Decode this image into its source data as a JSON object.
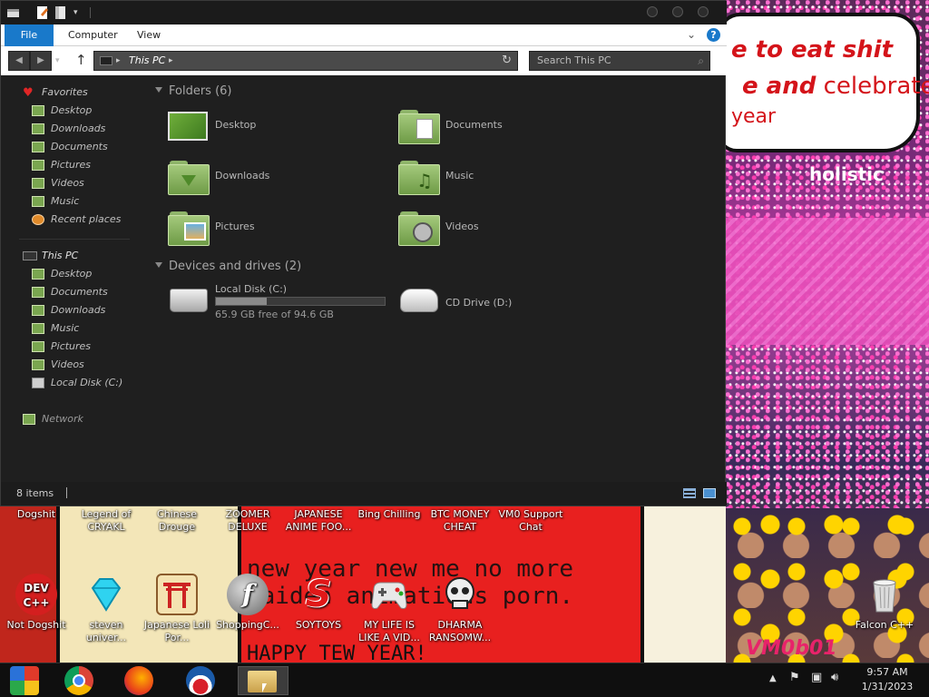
{
  "wallpaper": {
    "bubble_line1": "e to eat shit",
    "bubble_line2_bold": "e and",
    "bubble_line2_rest": "celebrate",
    "bubble_line3": "year",
    "sign_text": "holistic",
    "comic_text": "new year new me no more jaiden animations porn.",
    "comic_happy": "HAPPY TEW YEAR!",
    "signature": "VM0b01"
  },
  "desktop_icons": [
    {
      "label": "Dogshit"
    },
    {
      "label": "Legend of CRYAKL"
    },
    {
      "label": "Chinese Drouge"
    },
    {
      "label": "ZOOMER DELUXE"
    },
    {
      "label": "JAPANESE ANIME FOO..."
    },
    {
      "label": "Bing Chilling"
    },
    {
      "label": "BTC MONEY CHEAT"
    },
    {
      "label": "VM0 Support Chat"
    },
    {
      "label": "Not Dogshit",
      "glyph": "DEV C++"
    },
    {
      "label": "steven univer..."
    },
    {
      "label": "Japanese Loli Por..."
    },
    {
      "label": "ShoppingC..."
    },
    {
      "label": "SOYTOYS",
      "glyph": "S"
    },
    {
      "label": "MY LIFE IS LIKE A VID..."
    },
    {
      "label": "DHARMA RANSOMW..."
    },
    {
      "label": "Falcon C++"
    }
  ],
  "explorer": {
    "ribbon": {
      "file": "File",
      "computer": "Computer",
      "view": "View"
    },
    "address": "This PC",
    "search_placeholder": "Search This PC",
    "nav": {
      "favorites": "Favorites",
      "fav_items": [
        "Desktop",
        "Downloads",
        "Documents",
        "Pictures",
        "Videos",
        "Music",
        "Recent places"
      ],
      "this_pc": "This PC",
      "pc_items": [
        "Desktop",
        "Documents",
        "Downloads",
        "Music",
        "Pictures",
        "Videos",
        "Local Disk (C:)"
      ],
      "network": "Network"
    },
    "folders_header": "Folders (6)",
    "folders": [
      "Desktop",
      "Documents",
      "Downloads",
      "Music",
      "Pictures",
      "Videos"
    ],
    "devices_header": "Devices and drives (2)",
    "drives": [
      {
        "name": "Local Disk (C:)",
        "free_text": "65.9 GB free of 94.6 GB",
        "used_fraction": 0.303
      },
      {
        "name": "CD Drive (D:)"
      }
    ],
    "status": "8 items"
  },
  "taskbar": {
    "time": "9:57 AM",
    "date": "1/31/2023"
  },
  "colors": {
    "accent": "#1979ca",
    "folder_green": "#8fb56a",
    "window_bg": "#1f1f1f"
  }
}
